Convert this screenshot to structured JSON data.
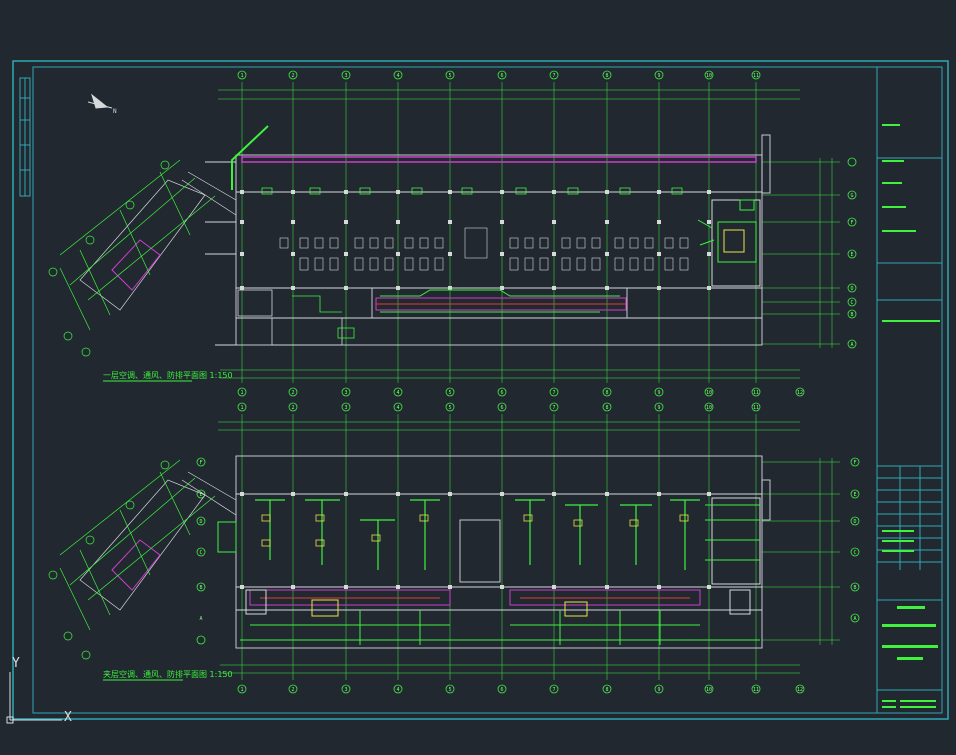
{
  "drawing": {
    "plan_upper_label": "一层空调、通风、防排平面图 1:150",
    "plan_lower_label": "夹层空调、通风、防排平面图 1:150",
    "ucs": {
      "y_label": "Y",
      "x_label": "X"
    },
    "grid_columns": [
      "1",
      "2",
      "3",
      "4",
      "5",
      "6",
      "7",
      "8",
      "9",
      "10",
      "11",
      "12"
    ],
    "grid_rows_upper": [
      "A",
      "B",
      "C",
      "D",
      "E",
      "F",
      "G"
    ],
    "grid_rows_lower": [
      "A",
      "B",
      "C",
      "D",
      "E",
      "F"
    ]
  },
  "colors": {
    "background": "#212830",
    "frame": "#2fa9b4",
    "lines": "#3ef23e",
    "walls": "#d5d9dc",
    "ducts": "#c940c9",
    "pipes": "#e03b3b",
    "equipment": "#e8e34a"
  }
}
